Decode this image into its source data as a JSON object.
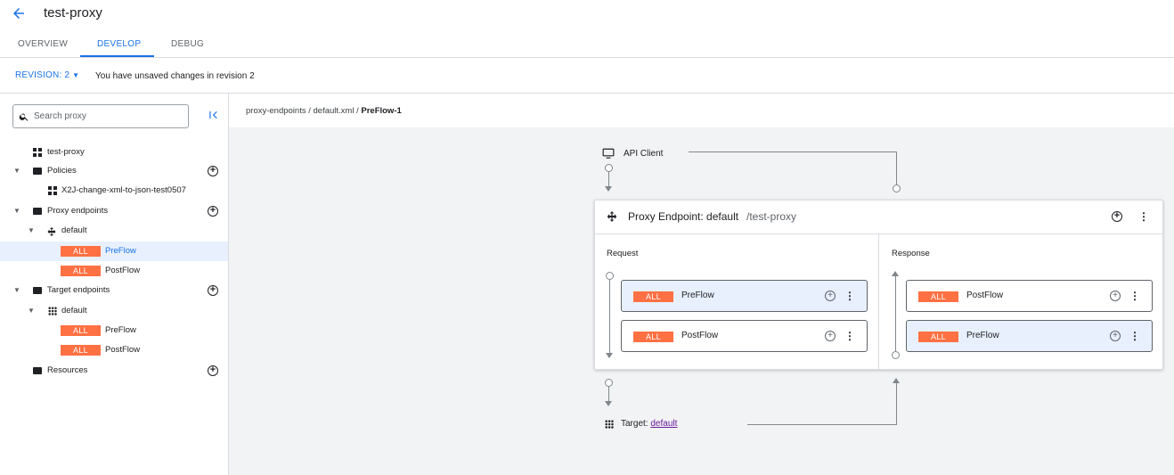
{
  "header": {
    "title": "test-proxy"
  },
  "tabs": [
    {
      "label": "OVERVIEW"
    },
    {
      "label": "DEVELOP"
    },
    {
      "label": "DEBUG"
    }
  ],
  "revision": {
    "label": "REVISION: 2",
    "message": "You have unsaved changes in revision 2"
  },
  "search": {
    "placeholder": "Search proxy"
  },
  "tree": {
    "root": "test-proxy",
    "policies": "Policies",
    "policy_item": "X2J-change-xml-to-json-test0507",
    "proxy_endpoints": "Proxy endpoints",
    "proxy_default": "default",
    "proxy_preflow": "PreFlow",
    "proxy_postflow": "PostFlow",
    "target_endpoints": "Target endpoints",
    "target_default": "default",
    "target_preflow": "PreFlow",
    "target_postflow": "PostFlow",
    "resources": "Resources",
    "badge": "ALL"
  },
  "breadcrumb": {
    "path": "proxy-endpoints / default.xml / ",
    "current": "PreFlow-1"
  },
  "flow": {
    "api_client": "API Client",
    "endpoint_title": "Proxy Endpoint: default",
    "endpoint_path": "/test-proxy",
    "request_label": "Request",
    "response_label": "Response",
    "badge": "ALL",
    "request_flows": [
      "PreFlow",
      "PostFlow"
    ],
    "response_flows": [
      "PostFlow",
      "PreFlow"
    ],
    "target_label": "Target:",
    "target_link": "default"
  },
  "colors": {
    "accent": "#1a73e8",
    "badge": "#ff7043",
    "selected": "#e8f0fe"
  }
}
